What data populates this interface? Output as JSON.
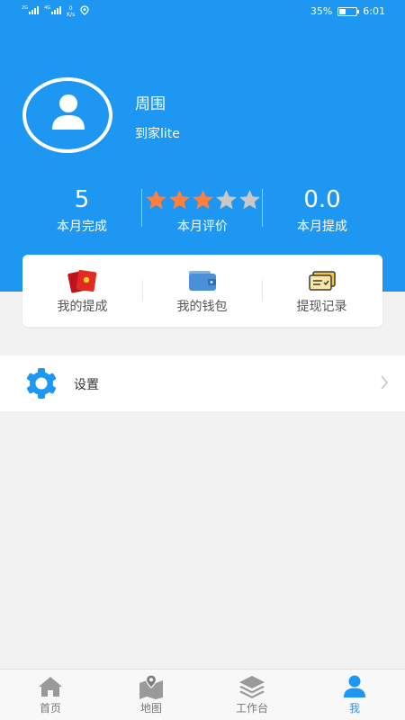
{
  "status_bar": {
    "sim1_label": "2G",
    "sim2_label": "4G",
    "net_speed_value": "0",
    "net_speed_unit": "K/s",
    "battery_percent": "35%",
    "battery_level": 0.35,
    "time": "6:01"
  },
  "profile": {
    "name": "周围",
    "subtitle": "到家lite"
  },
  "stats": {
    "completed": {
      "value": "5",
      "label": "本月完成"
    },
    "rating": {
      "stars_total": 5,
      "stars_filled": 3,
      "label": "本月评价"
    },
    "commission": {
      "value": "0.0",
      "label": "本月提成"
    }
  },
  "quick_actions": [
    {
      "label": "我的提成",
      "icon": "red-envelope-icon"
    },
    {
      "label": "我的钱包",
      "icon": "wallet-icon"
    },
    {
      "label": "提现记录",
      "icon": "cards-record-icon"
    }
  ],
  "settings": {
    "label": "设置",
    "icon": "gear-icon"
  },
  "bottom_nav": [
    {
      "label": "首页",
      "icon": "home-icon",
      "active": false
    },
    {
      "label": "地图",
      "icon": "map-icon",
      "active": false
    },
    {
      "label": "工作台",
      "icon": "layers-icon",
      "active": false
    },
    {
      "label": "我",
      "icon": "person-icon",
      "active": true
    }
  ],
  "colors": {
    "accent": "#1e97f2",
    "star_filled": "#ff7f3f",
    "star_empty": "#c8c8c8",
    "background": "#f2f2f2"
  }
}
